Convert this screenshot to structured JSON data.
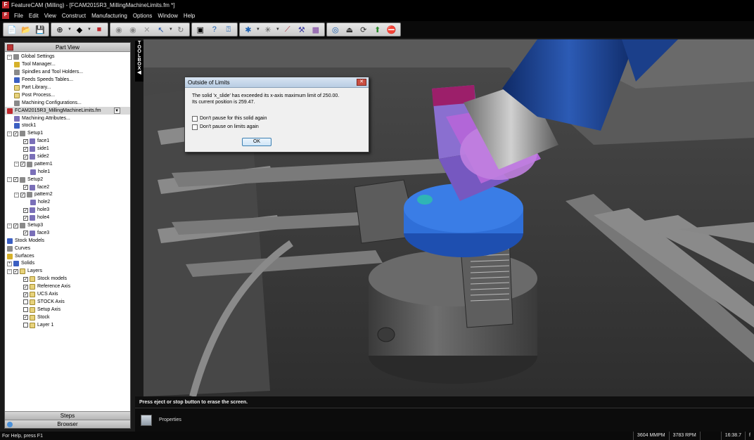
{
  "window": {
    "title": "FeatureCAM (Milling) - [FCAM2015R3_MillingMachineLimits.fm *]",
    "app_icon": "F"
  },
  "menu": [
    "File",
    "Edit",
    "View",
    "Construct",
    "Manufacturing",
    "Options",
    "Window",
    "Help"
  ],
  "toolbar_icons": [
    "new-file-icon",
    "open-folder-icon",
    "save-icon",
    "globe-view-icon",
    "shaded-view-icon",
    "eraser-icon",
    "circle-icon",
    "circle-icon",
    "x-icon",
    "cursor-select-icon",
    "rotate-icon",
    "screenshot-icon",
    "help-icon",
    "question-icon",
    "move-icon",
    "snap-icon",
    "curve-icon",
    "tool-icon",
    "cube-icon",
    "simulation-icon",
    "eject-icon",
    "step-icon",
    "arrow-icon",
    "stop-icon"
  ],
  "left_panel": {
    "header": "Part View",
    "tree": [
      {
        "label": "Global Settings",
        "level": 0,
        "exp": "−",
        "icon": "ic-gray"
      },
      {
        "label": "Tool Manager...",
        "level": 1,
        "icon": "ic-yellow"
      },
      {
        "label": "Spindles and Tool Holders...",
        "level": 1,
        "icon": "ic-gray"
      },
      {
        "label": "Feeds  Speeds Tables...",
        "level": 1,
        "icon": "ic-blue"
      },
      {
        "label": "Part Library...",
        "level": 1,
        "icon": "ic-sheet"
      },
      {
        "label": "Post Process...",
        "level": 1,
        "icon": "ic-sheet"
      },
      {
        "label": "Machining Configurations...",
        "level": 1,
        "icon": "ic-gray"
      },
      {
        "label": "FCAM2015R3_MillingMachineLimits.fm",
        "level": 0,
        "icon": "ic-red",
        "selected": true,
        "dropdown": "▼"
      },
      {
        "label": "Machining Attributes...",
        "level": 1,
        "icon": "ic-purple"
      },
      {
        "label": "stock1",
        "level": 1,
        "icon": "ic-blue"
      },
      {
        "label": "Setup1",
        "level": 0,
        "exp": "−",
        "chk": "✓",
        "icon": "ic-gray"
      },
      {
        "label": "face1",
        "level": 2,
        "chk": "✓",
        "icon": "ic-purple"
      },
      {
        "label": "side1",
        "level": 2,
        "chk": "✓",
        "icon": "ic-purple"
      },
      {
        "label": "side2",
        "level": 2,
        "chk": "✓",
        "icon": "ic-purple"
      },
      {
        "label": "pattern1",
        "level": 1,
        "exp": "−",
        "chk": "✓",
        "icon": "ic-gray"
      },
      {
        "label": "hole1",
        "level": 3,
        "icon": "ic-purple"
      },
      {
        "label": "Setup2",
        "level": 0,
        "exp": "−",
        "chk": "✓",
        "icon": "ic-gray"
      },
      {
        "label": "face2",
        "level": 2,
        "chk": "✓",
        "icon": "ic-purple"
      },
      {
        "label": "pattern2",
        "level": 1,
        "exp": "−",
        "chk": "✓",
        "icon": "ic-gray"
      },
      {
        "label": "hole2",
        "level": 3,
        "icon": "ic-purple"
      },
      {
        "label": "hole3",
        "level": 2,
        "chk": "✓",
        "icon": "ic-purple"
      },
      {
        "label": "hole4",
        "level": 2,
        "chk": "✓",
        "icon": "ic-purple"
      },
      {
        "label": "Setup3",
        "level": 0,
        "exp": "−",
        "chk": "✓",
        "icon": "ic-gray"
      },
      {
        "label": "face3",
        "level": 2,
        "chk": "✓",
        "icon": "ic-purple"
      },
      {
        "label": "Stock Models",
        "level": 0,
        "icon": "ic-blue"
      },
      {
        "label": "Curves",
        "level": 0,
        "icon": "ic-gray"
      },
      {
        "label": "Surfaces",
        "level": 0,
        "icon": "ic-yellow"
      },
      {
        "label": "Solids",
        "level": 0,
        "exp": "+",
        "icon": "ic-blue"
      },
      {
        "label": "Layers",
        "level": 0,
        "exp": "−",
        "chk": "✓",
        "icon": "ic-sheet"
      },
      {
        "label": "Stock models",
        "level": 2,
        "chk": "✓",
        "icon": "ic-sheet"
      },
      {
        "label": "Reference Axis",
        "level": 2,
        "chk": "✓",
        "icon": "ic-sheet"
      },
      {
        "label": "UCS Axis",
        "level": 2,
        "chk": "✓",
        "icon": "ic-sheet"
      },
      {
        "label": "STOCK Axis",
        "level": 2,
        "chk": "",
        "icon": "ic-sheet"
      },
      {
        "label": "Setup Axis",
        "level": 2,
        "chk": "",
        "icon": "ic-sheet"
      },
      {
        "label": "Stock",
        "level": 2,
        "chk": "✓",
        "icon": "ic-sheet"
      },
      {
        "label": "Layer 1",
        "level": 2,
        "chk": "",
        "icon": "ic-sheet"
      }
    ],
    "tabs": [
      "Steps",
      "Browser"
    ]
  },
  "toolbox_label": "TOOLBOX",
  "dialog": {
    "title": "Outside of Limits",
    "line1": "The solid 'x_slide' has exceeded its x-axis maximum limit of 250.00.",
    "line2": "Its current position is 259.47.",
    "opt1": "Don't pause for this solid again",
    "opt2": "Don't pause on limits again",
    "ok": "OK"
  },
  "message": "Press eject or stop button to erase the screen.",
  "properties_label": "Properties",
  "status": {
    "help": "For Help, press F1",
    "feed": "3604 MMPM",
    "speed": "3783 RPM",
    "time": "16:38.7",
    "extra": "f"
  },
  "colors": {
    "part_blue": "#2f6fd8",
    "part_purple": "#8a6fd0",
    "tool_blue": "#1b3f8a",
    "chuck_gray": "#5a5a5a"
  }
}
